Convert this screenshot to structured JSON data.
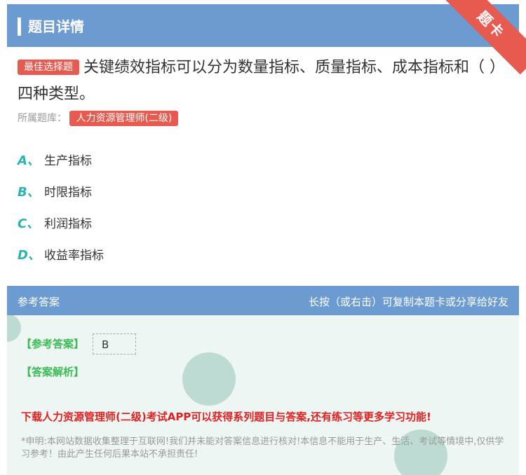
{
  "header": {
    "title": "题目详情",
    "ribbon": "题卡"
  },
  "question": {
    "tag": "最佳选择题",
    "text": "关键绩效指标可以分为数量指标、质量指标、成本指标和（ ）四种类型。"
  },
  "source": {
    "label": "所属题库：",
    "bank": "人力资源管理师(二级)"
  },
  "options": [
    {
      "letter": "A、",
      "text": "生产指标"
    },
    {
      "letter": "B、",
      "text": "时限指标"
    },
    {
      "letter": "C、",
      "text": "利润指标"
    },
    {
      "letter": "D、",
      "text": "收益率指标"
    }
  ],
  "answer": {
    "head_left": "参考答案",
    "head_right": "长按（或右击）可复制本题卡或分享给好友",
    "ref_label": "【参考答案】",
    "ref_value": "B",
    "analysis_label": "【答案解析】",
    "promo": "下载人力资源管理师(二级)考试APP可以获得系列题目与答案,还有练习等更多学习功能!",
    "disclaimer": "*申明:本网站数据收集整理于互联网!我们并未能对答案信息进行核对!本信息不能用于生产、生活、考试等情境中,仅供学习参考！由此产生任何后果本站不承担责任!"
  },
  "colors": {
    "header": "#6b9bd1",
    "accent_red": "#e65a4f",
    "option_letter": "#2ab3b3",
    "answer_green": "#3cba54"
  }
}
